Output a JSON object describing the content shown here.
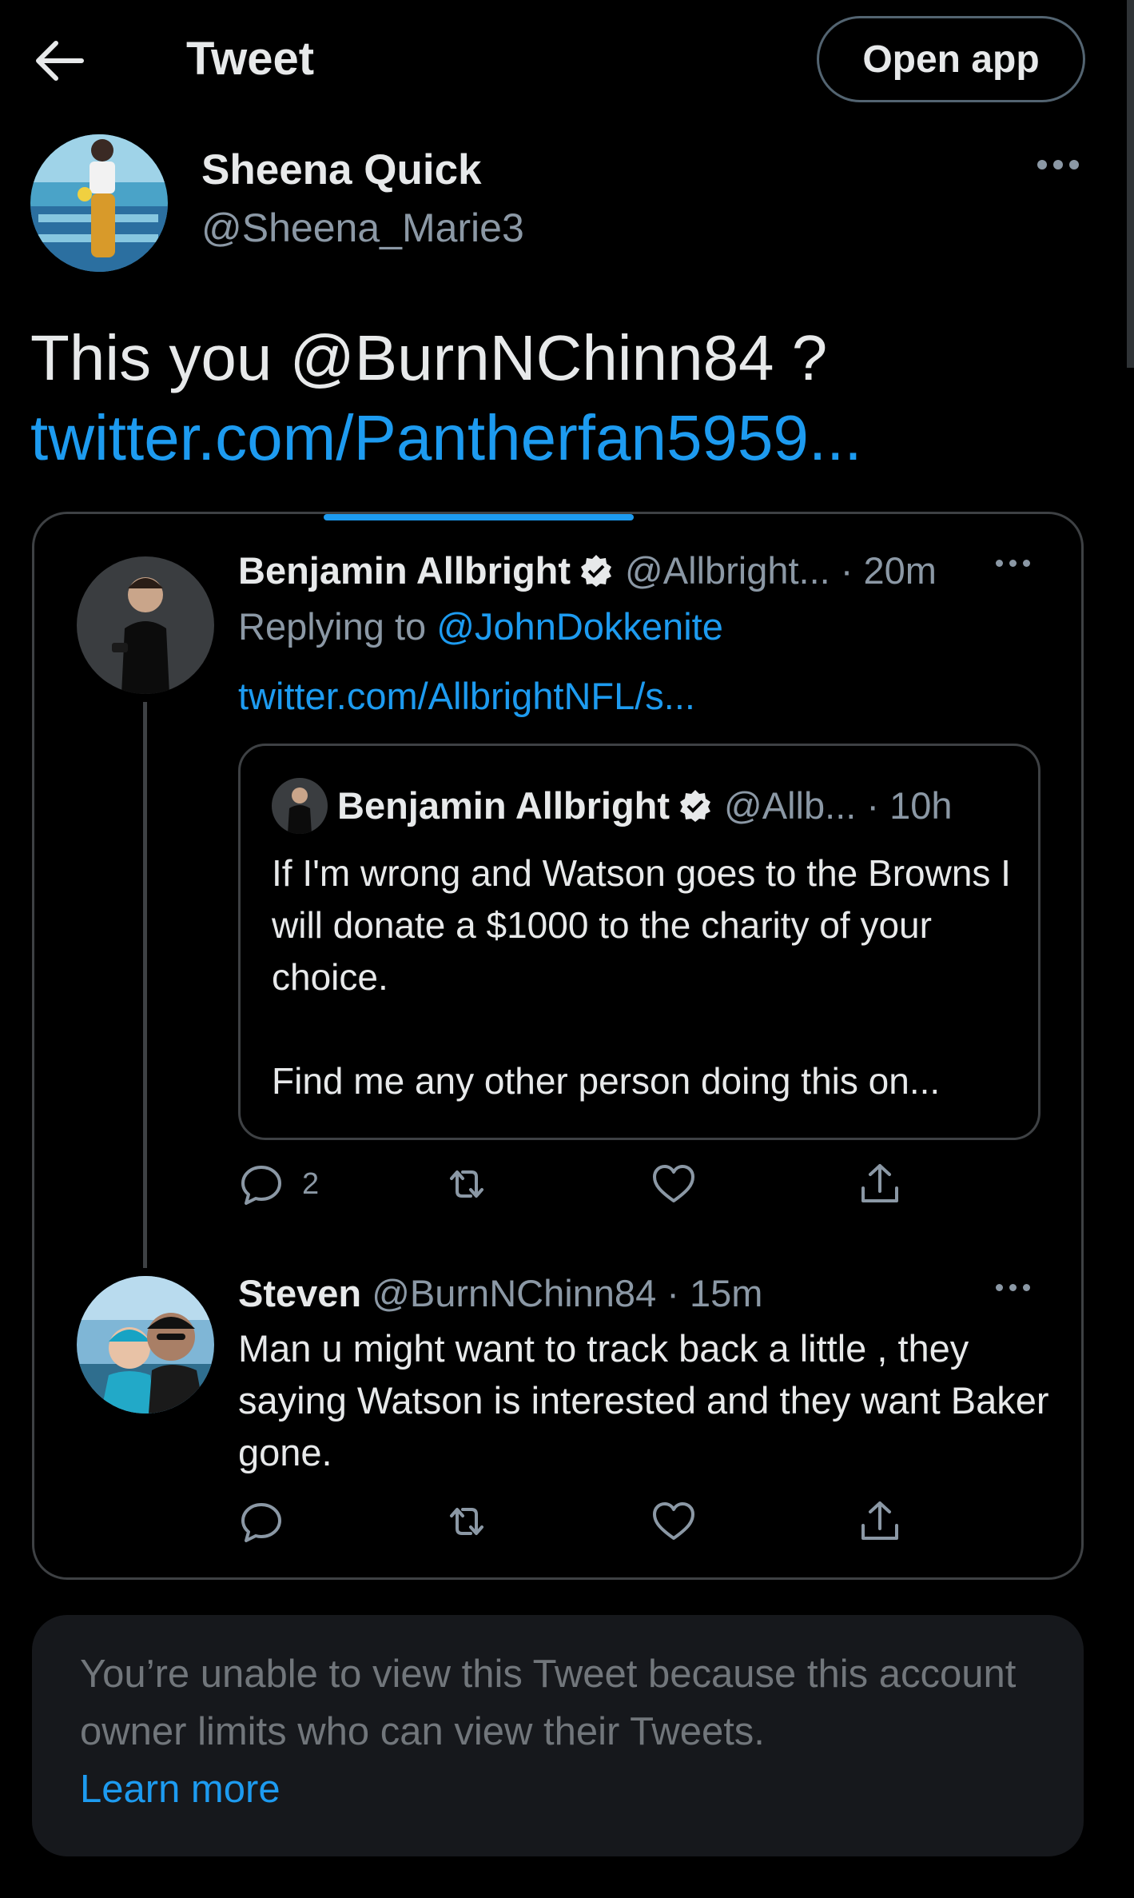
{
  "header": {
    "title": "Tweet",
    "open_app_label": "Open app"
  },
  "tweet": {
    "author_name": "Sheena Quick",
    "author_handle": "@Sheena_Marie3",
    "text": "This you @BurnNChinn84 ?",
    "link": "twitter.com/Pantherfan5959..."
  },
  "thread": {
    "first": {
      "name": "Benjamin Allbright",
      "handle_time": "@Allbright... · 20m",
      "replying_prefix": "Replying to ",
      "replying_to": "@JohnDokkenite",
      "link": "twitter.com/AllbrightNFL/s...",
      "quoted": {
        "name": "Benjamin Allbright",
        "handle_time": "@Allb... · 10h",
        "text": "If I'm wrong and Watson goes to the Browns I will donate a $1000 to the charity of your choice.",
        "text2": "Find me any other person doing this on..."
      },
      "reply_count": "2"
    },
    "second": {
      "name": "Steven",
      "handle_time": "@BurnNChinn84 · 15m",
      "text": "Man u might want to track back a little , they saying Watson is interested and they want Baker gone."
    }
  },
  "notice": {
    "text": "You’re unable to view this Tweet because this account owner limits who can view their Tweets.",
    "learn_more": "Learn more"
  },
  "icons": {
    "back": "arrow-left-icon",
    "more": "more-horizontal-icon",
    "verified": "verified-badge-icon",
    "reply": "reply-icon",
    "retweet": "retweet-icon",
    "like": "heart-icon",
    "share": "share-icon"
  },
  "colors": {
    "background": "#000000",
    "accent": "#1d9bf0",
    "secondary_text": "#8b98a5",
    "border": "#3e4144"
  }
}
